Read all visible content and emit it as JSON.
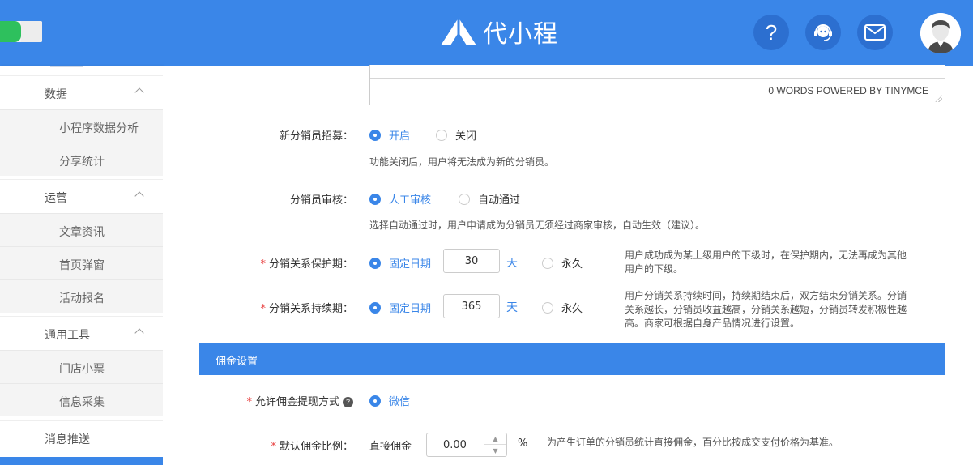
{
  "header": {
    "brand": "代小程",
    "help_label": "?",
    "icons": [
      "question-icon",
      "customer-service-icon",
      "mail-icon",
      "user-avatar"
    ]
  },
  "sidebar": {
    "groups": [
      {
        "label": "数据",
        "items": [
          "小程序数据分析",
          "分享统计"
        ]
      },
      {
        "label": "运营",
        "items": [
          "文章资讯",
          "首页弹窗",
          "活动报名"
        ]
      },
      {
        "label": "通用工具",
        "items": [
          "门店小票",
          "信息采集"
        ]
      },
      {
        "label": "消息推送",
        "items": []
      }
    ]
  },
  "editor": {
    "status": "0 WORDS POWERED BY TINYMCE"
  },
  "form": {
    "recruit": {
      "label": "新分销员招募：",
      "opt_on": "开启",
      "opt_off": "关闭",
      "hint": "功能关闭后，用户将无法成为新的分销员。"
    },
    "review": {
      "label": "分销员审核：",
      "opt_manual": "人工审核",
      "opt_auto": "自动通过",
      "hint": "选择自动通过时，用户申请成为分销员无须经过商家审核，自动生效（建议）。"
    },
    "protect": {
      "required": "*",
      "label": "分销关系保护期：",
      "opt_fixed": "固定日期",
      "value": "30",
      "unit": "天",
      "opt_forever": "永久",
      "hint": "用户成功成为某上级用户的下级时，在保护期内，无法再成为其他用户的下级。"
    },
    "duration": {
      "required": "*",
      "label": "分销关系持续期：",
      "opt_fixed": "固定日期",
      "value": "365",
      "unit": "天",
      "opt_forever": "永久",
      "hint": "用户分销关系持续时间，持续期结束后，双方结束分销关系。分销关系越长，分销员收益越高，分销关系越短，分销员转发积极性越高。商家可根据自身产品情况进行设置。"
    }
  },
  "commission": {
    "section_title": "佣金设置",
    "withdraw": {
      "required": "*",
      "label": "允许佣金提现方式",
      "help": "?",
      "opt_wechat": "微信"
    },
    "ratio": {
      "required": "*",
      "label": "默认佣金比例：",
      "sub_label": "直接佣金",
      "value": "0.00",
      "unit": "%",
      "hint": "为产生订单的分销员统计直接佣金，百分比按成交支付价格为基准。"
    }
  },
  "colors": {
    "primary": "#3a86e8",
    "required": "#e84040",
    "toggle_green": "#2ec05d"
  }
}
